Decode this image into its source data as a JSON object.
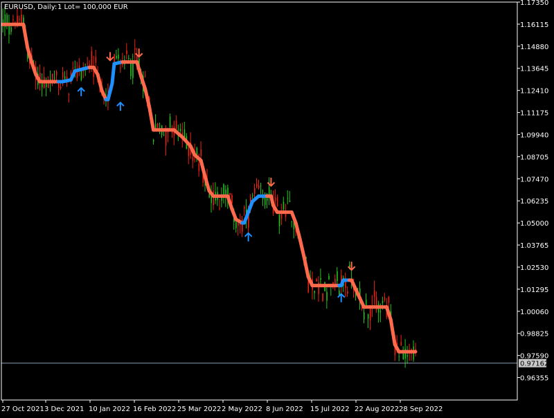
{
  "header": {
    "symbol_label": "EURUSD, Daily:",
    "lot_label": "1 Lot= 100,000 EUR"
  },
  "colors": {
    "background": "#000000",
    "axis": "#ffffff",
    "bull": "#22c51a",
    "bear": "#ee2211",
    "line_down": "#ff6a4d",
    "line_up": "#1e90ff",
    "price_line": "#8aa0b4",
    "price_box_bg": "#c8c8c8",
    "price_box_text": "#000000"
  },
  "current_price": "0.97162",
  "chart_data": {
    "type": "candlestick",
    "y_tick_labels": [
      "1.17350",
      "1.16115",
      "1.14880",
      "1.13645",
      "1.12410",
      "1.11175",
      "1.09940",
      "1.08705",
      "1.07470",
      "1.06235",
      "1.05000",
      "1.03765",
      "1.02530",
      "1.01295",
      "1.00060",
      "0.98825",
      "0.97590",
      "0.96355"
    ],
    "x_tick_labels": [
      "27 Oct 2021",
      "3 Dec 2021",
      "10 Jan 2022",
      "16 Feb 2022",
      "25 Mar 2022",
      "2 May 2022",
      "8 Jun 2022",
      "15 Jul 2022",
      "22 Aug 2022",
      "28 Sep 2022"
    ],
    "ylim": [
      0.951,
      1.1735
    ],
    "trend_line": [
      [
        0,
        1.161,
        "down"
      ],
      [
        10,
        1.161,
        "down"
      ],
      [
        12,
        1.148,
        "down"
      ],
      [
        14,
        1.14,
        "down"
      ],
      [
        16,
        1.133,
        "down"
      ],
      [
        18,
        1.129,
        "down"
      ],
      [
        27,
        1.129,
        "down"
      ],
      [
        29,
        1.129,
        "up"
      ],
      [
        33,
        1.13,
        "up"
      ],
      [
        35,
        1.135,
        "up"
      ],
      [
        42,
        1.137,
        "up"
      ],
      [
        44,
        1.137,
        "down"
      ],
      [
        46,
        1.133,
        "down"
      ],
      [
        48,
        1.124,
        "down"
      ],
      [
        50,
        1.119,
        "down"
      ],
      [
        51,
        1.119,
        "up"
      ],
      [
        53,
        1.128,
        "up"
      ],
      [
        54,
        1.139,
        "up"
      ],
      [
        58,
        1.14,
        "up"
      ],
      [
        60,
        1.14,
        "down"
      ],
      [
        65,
        1.14,
        "down"
      ],
      [
        67,
        1.132,
        "down"
      ],
      [
        69,
        1.125,
        "down"
      ],
      [
        71,
        1.115,
        "down"
      ],
      [
        73,
        1.102,
        "down"
      ],
      [
        83,
        1.102,
        "down"
      ],
      [
        87,
        1.098,
        "down"
      ],
      [
        91,
        1.093,
        "down"
      ],
      [
        93,
        1.088,
        "down"
      ],
      [
        96,
        1.085,
        "down"
      ],
      [
        98,
        1.076,
        "down"
      ],
      [
        100,
        1.068,
        "down"
      ],
      [
        102,
        1.065,
        "down"
      ],
      [
        109,
        1.065,
        "down"
      ],
      [
        111,
        1.058,
        "down"
      ],
      [
        113,
        1.052,
        "down"
      ],
      [
        116,
        1.05,
        "down"
      ],
      [
        117,
        1.05,
        "up"
      ],
      [
        119,
        1.056,
        "up"
      ],
      [
        121,
        1.062,
        "up"
      ],
      [
        124,
        1.065,
        "up"
      ],
      [
        128,
        1.065,
        "up"
      ],
      [
        130,
        1.065,
        "down"
      ],
      [
        131,
        1.06,
        "down"
      ],
      [
        133,
        1.056,
        "down"
      ],
      [
        140,
        1.056,
        "down"
      ],
      [
        142,
        1.05,
        "down"
      ],
      [
        144,
        1.041,
        "down"
      ],
      [
        146,
        1.031,
        "down"
      ],
      [
        148,
        1.02,
        "down"
      ],
      [
        150,
        1.015,
        "down"
      ],
      [
        163,
        1.015,
        "down"
      ],
      [
        164,
        1.015,
        "up"
      ],
      [
        165,
        1.018,
        "up"
      ],
      [
        168,
        1.018,
        "up"
      ],
      [
        169,
        1.018,
        "down"
      ],
      [
        171,
        1.013,
        "down"
      ],
      [
        173,
        1.008,
        "down"
      ],
      [
        175,
        1.003,
        "down"
      ],
      [
        180,
        1.003,
        "down"
      ],
      [
        186,
        1.003,
        "down"
      ],
      [
        188,
        0.996,
        "down"
      ],
      [
        190,
        0.982,
        "down"
      ],
      [
        192,
        0.978,
        "down"
      ],
      [
        200,
        0.978,
        "down"
      ]
    ],
    "signals": [
      [
        38,
        1.1232,
        "up"
      ],
      [
        52,
        1.1432,
        "down"
      ],
      [
        57,
        1.115,
        "up"
      ],
      [
        66,
        1.1452,
        "down"
      ],
      [
        119,
        1.042,
        "up"
      ],
      [
        130,
        1.073,
        "down"
      ],
      [
        164,
        1.008,
        "up"
      ],
      [
        169,
        1.026,
        "down"
      ]
    ],
    "last_bar_index": 200
  }
}
